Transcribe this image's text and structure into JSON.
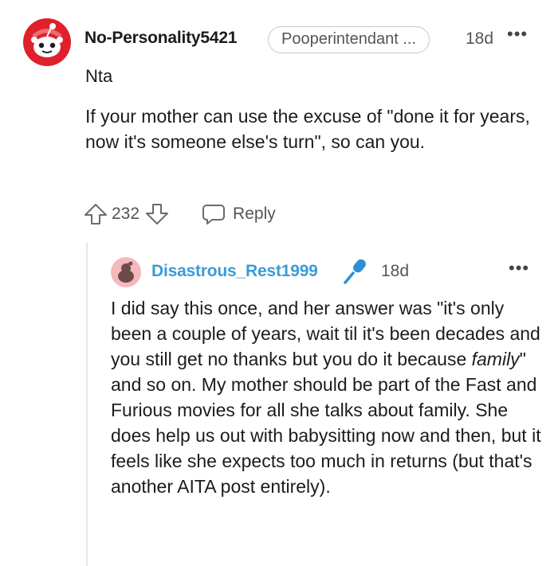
{
  "comment": {
    "username": "No-Personality5421",
    "flair": "Pooperintendant ...",
    "timestamp": "18d",
    "more_label": "•••",
    "short_text": "Nta",
    "body": "If your mother can use the excuse of \"done it for years, now it's someone else's turn\", so can you.",
    "vote_count": "232",
    "reply_label": "Reply",
    "avatar_color": "#e0202a"
  },
  "reply": {
    "username": "Disastrous_Rest1999",
    "timestamp": "18d",
    "more_label": "•••",
    "body_part1": "I did say this once, and her answer was \"it's only been a couple of years, wait til it's been decades and you still get no thanks but you do it because ",
    "body_italic": "family",
    "body_part2": "\" and so on. My mother should be part of the Fast and Furious movies for all she talks about family. She does help us out with babysitting now and then, but it feels like she expects too much in returns (but that's another AITA post entirely).",
    "username_color": "#3b9bd5",
    "avatar_color": "#f4b8bd"
  }
}
